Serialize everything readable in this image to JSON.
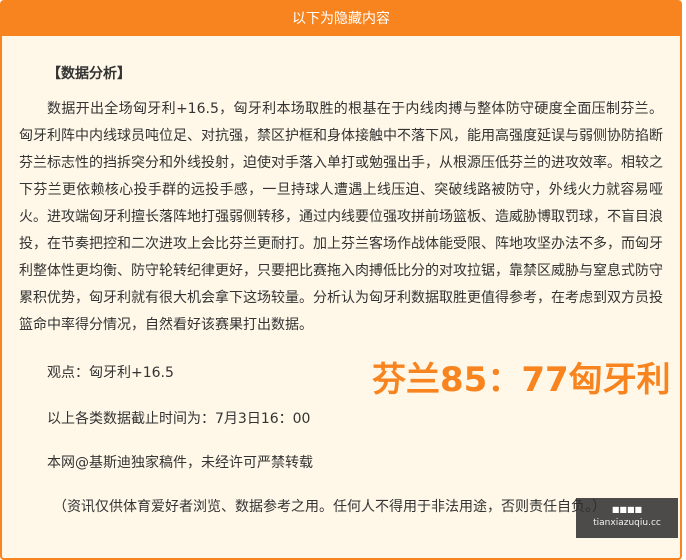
{
  "header": {
    "title": "以下为隐藏内容"
  },
  "article": {
    "heading": "【数据分析】",
    "body": "数据开出全场匈牙利+16.5，匈牙利本场取胜的根基在于内线肉搏与整体防守硬度全面压制芬兰。匈牙利阵中内线球员吨位足、对抗强，禁区护框和身体接触中不落下风，能用高强度延误与弱侧协防掐断芬兰标志性的挡拆突分和外线投射，迫使对手落入单打或勉强出手，从根源压低芬兰的进攻效率。相较之下芬兰更依赖核心投手群的远投手感，一旦持球人遭遇上线压迫、突破线路被防守，外线火力就容易哑火。进攻端匈牙利擅长落阵地打强弱侧转移，通过内线要位强攻拼前场篮板、造威胁博取罚球，不盲目浪投，在节奏把控和二次进攻上会比芬兰更耐打。加上芬兰客场作战体能受限、阵地攻坚办法不多，而匈牙利整体性更均衡、防守轮转纪律更好，只要把比赛拖入肉搏低比分的对攻拉锯，靠禁区威胁与窒息式防守累积优势，匈牙利就有很大机会拿下这场较量。分析认为匈牙利数据取胜更值得参考，在考虑到双方员投篮命中率得分情况，自然看好该赛果打出数据。",
    "viewpoint": "观点：匈牙利+16.5",
    "cutoff": "以上各类数据截止时间为：7月3日16：00",
    "copyright": "本网@基斯迪独家稿件，未经许可严禁转载",
    "disclaimer": "（资讯仅供体育爱好者浏览、数据参考之用。任何人不得用于非法用途，否则责任自负。）"
  },
  "score_overlay": {
    "text": "芬兰85：77匈牙利"
  },
  "watermark": {
    "title": "■■■■",
    "url": "tianxiazuqiu.cc"
  },
  "colors": {
    "accent": "#f7841f",
    "panel_bg": "#fff8e9",
    "text": "#333333"
  }
}
